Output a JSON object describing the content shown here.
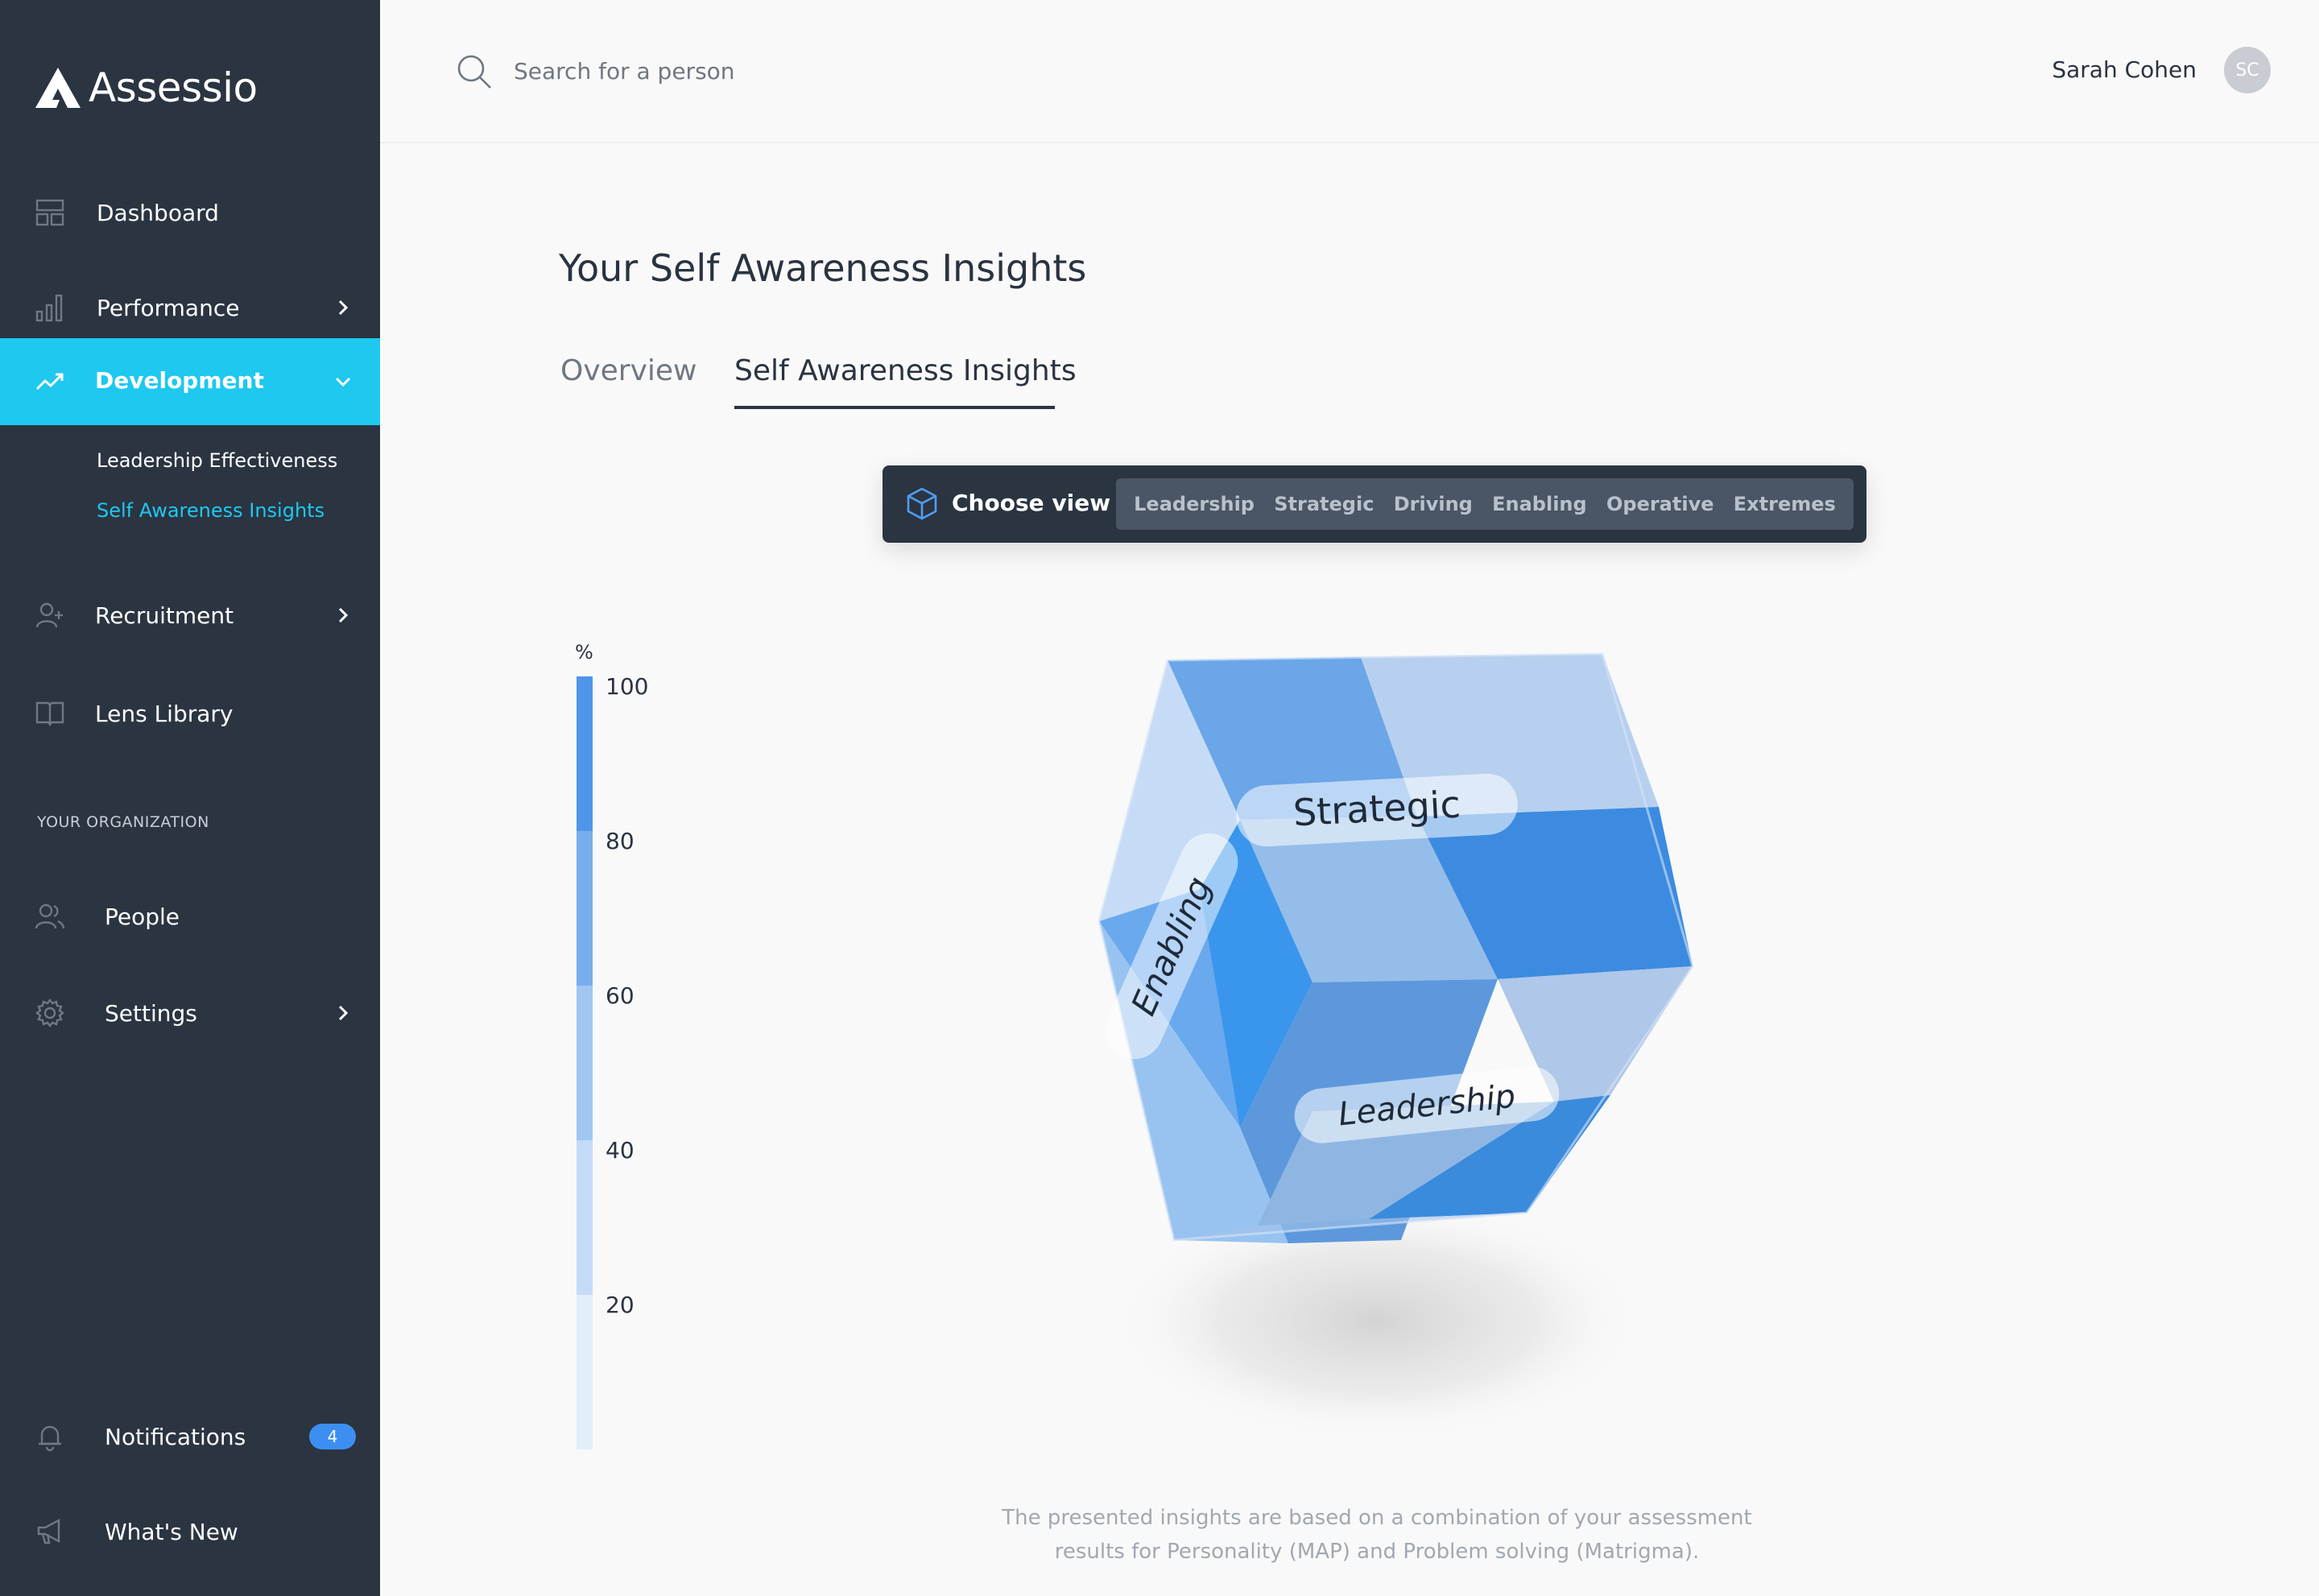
{
  "app": {
    "brand": "Assessio"
  },
  "sidebar": {
    "items": [
      {
        "label": "Dashboard",
        "icon": "dashboard-icon"
      },
      {
        "label": "Performance",
        "icon": "bar-chart-icon"
      },
      {
        "label": "Development",
        "icon": "trending-up-icon"
      },
      {
        "label": "Recruitment",
        "icon": "add-user-icon"
      },
      {
        "label": "Lens Library",
        "icon": "book-icon"
      }
    ],
    "development_sub": [
      {
        "label": "Leadership Effectiveness"
      },
      {
        "label": "Self Awareness Insights"
      }
    ],
    "section_label": "YOUR ORGANIZATION",
    "org_items": [
      {
        "label": "People",
        "icon": "people-icon"
      },
      {
        "label": "Settings",
        "icon": "gear-icon"
      }
    ],
    "bottom_items": [
      {
        "label": "Notifications",
        "icon": "bell-icon",
        "badge": "4"
      },
      {
        "label": "What's New",
        "icon": "megaphone-icon"
      }
    ]
  },
  "header": {
    "search_placeholder": "Search for a person",
    "user_name": "Sarah Cohen",
    "user_initials": "SC"
  },
  "main": {
    "title": "Your Self Awareness Insights",
    "tabs": [
      {
        "label": "Overview"
      },
      {
        "label": "Self Awareness Insights"
      }
    ],
    "choose_view_label": "Choose view",
    "view_options": [
      "Leadership",
      "Strategic",
      "Driving",
      "Enabling",
      "Operative",
      "Extremes"
    ],
    "scale": {
      "unit": "%",
      "labels": [
        "100",
        "80",
        "60",
        "40",
        "20"
      ]
    },
    "cube_labels": {
      "top": "Strategic",
      "left": "Enabling",
      "bottom": "Leadership"
    },
    "footnote_line1": "The presented insights are based on a combination of your assessment",
    "footnote_line2": "results for Personality (MAP) and Problem solving (Matrigma)."
  },
  "colors": {
    "sidebar_bg": "#2b3441",
    "accent": "#1ec8ef",
    "badge": "#3c8ff1",
    "scale": [
      "#4f96ea",
      "#77aeee",
      "#a0c6f2",
      "#c3dbf6",
      "#e3eefb"
    ]
  }
}
